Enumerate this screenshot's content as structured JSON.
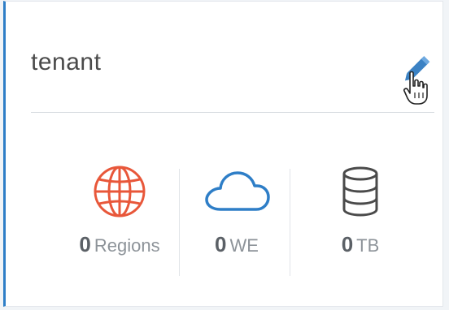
{
  "card": {
    "title": "tenant",
    "edit_icon": "pencil-icon",
    "cursor_icon": "hand-pointer-icon",
    "stats": [
      {
        "value": "0",
        "unit": "Regions",
        "icon": "globe-icon",
        "color": "#e8573a"
      },
      {
        "value": "0",
        "unit": "WE",
        "icon": "cloud-icon",
        "color": "#2e7ec7"
      },
      {
        "value": "0",
        "unit": "TB",
        "icon": "database-icon",
        "color": "#4a4a4a"
      }
    ]
  }
}
